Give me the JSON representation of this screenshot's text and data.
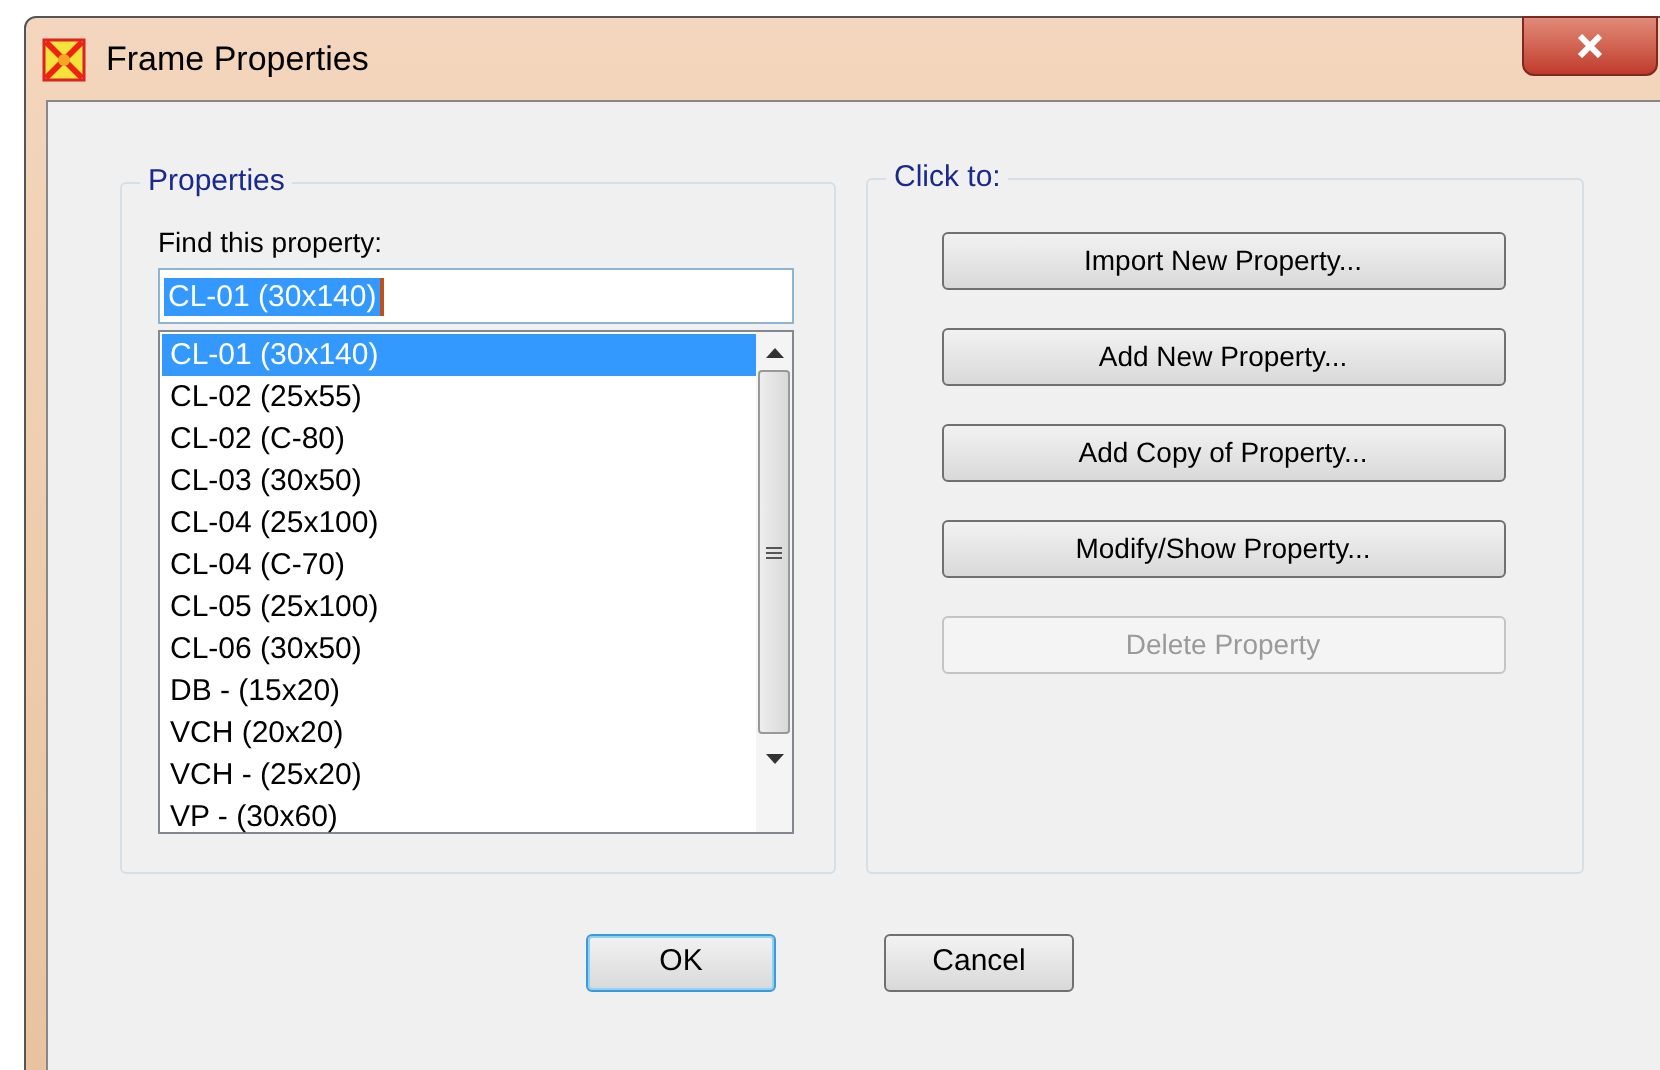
{
  "window": {
    "title": "Frame Properties"
  },
  "properties": {
    "title": "Properties",
    "find_label": "Find this property:",
    "find_value": "CL-01 (30x140)",
    "items": [
      {
        "label": "CL-01 (30x140)",
        "selected": true
      },
      {
        "label": "CL-02 (25x55)",
        "selected": false
      },
      {
        "label": "CL-02 (C-80)",
        "selected": false
      },
      {
        "label": "CL-03 (30x50)",
        "selected": false
      },
      {
        "label": "CL-04 (25x100)",
        "selected": false
      },
      {
        "label": "CL-04 (C-70)",
        "selected": false
      },
      {
        "label": "CL-05 (25x100)",
        "selected": false
      },
      {
        "label": "CL-06 (30x50)",
        "selected": false
      },
      {
        "label": "DB - (15x20)",
        "selected": false
      },
      {
        "label": "VCH (20x20)",
        "selected": false
      },
      {
        "label": "VCH - (25x20)",
        "selected": false
      },
      {
        "label": "VP - (30x60)",
        "selected": false
      }
    ]
  },
  "actions": {
    "title": "Click to:",
    "buttons": [
      {
        "label": "Import New Property...",
        "disabled": false
      },
      {
        "label": "Add New Property...",
        "disabled": false
      },
      {
        "label": "Add Copy of Property...",
        "disabled": false
      },
      {
        "label": "Modify/Show Property...",
        "disabled": false
      },
      {
        "label": "Delete Property",
        "disabled": true
      }
    ]
  },
  "footer": [
    {
      "label": "OK",
      "default": true
    },
    {
      "label": "Cancel",
      "default": false
    }
  ]
}
